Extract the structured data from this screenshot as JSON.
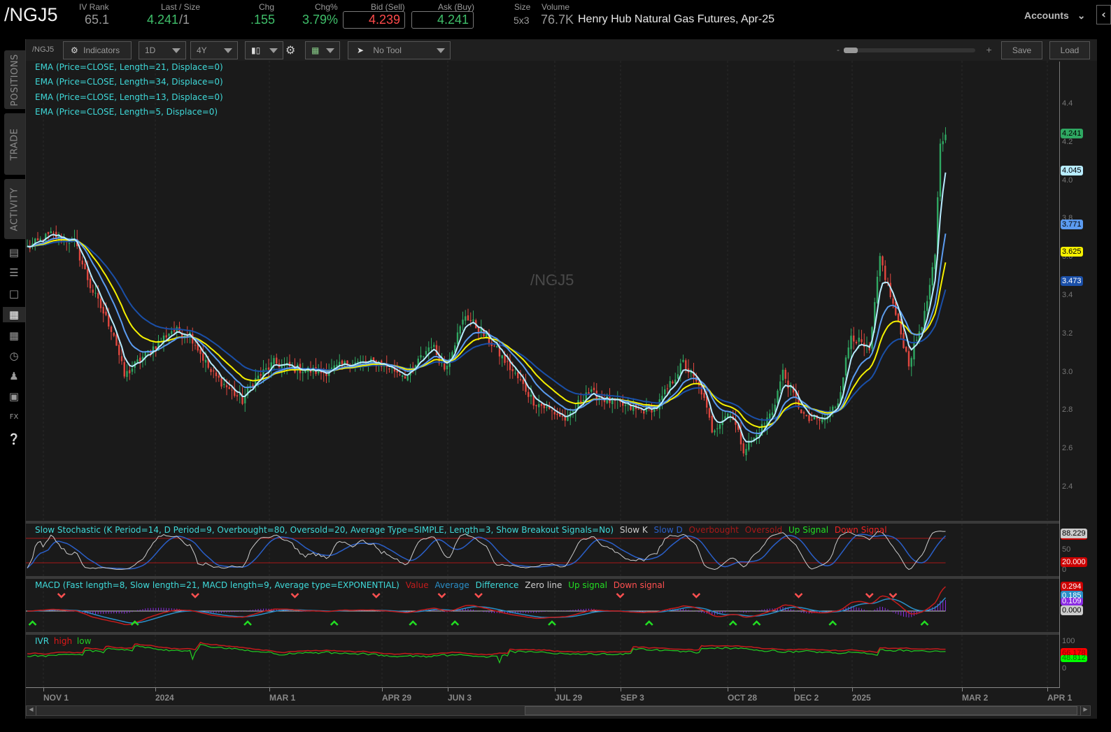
{
  "header": {
    "symbol": "/NGJ5",
    "iv_rank_label": "IV Rank",
    "iv_rank": "65.1",
    "last_size_label": "Last / Size",
    "last": "4.241",
    "size_suffix": "/1",
    "chg_label": "Chg",
    "chg": ".155",
    "chg_pct_label": "Chg%",
    "chg_pct": "3.79%",
    "bid_label": "Bid (Sell)",
    "bid": "4.239",
    "ask_label": "Ask (Buy)",
    "ask": "4.241",
    "size_label": "Size",
    "size": "5x3",
    "volume_label": "Volume",
    "volume": "76.7K",
    "description": "Henry Hub Natural Gas Futures, Apr-25",
    "accounts_label": "Accounts"
  },
  "sidebar": {
    "tabs": [
      "POSITIONS",
      "TRADE",
      "ACTIVITY"
    ],
    "icons": [
      "analyze-icon",
      "watchlist-icon",
      "tv-icon",
      "chart-icon",
      "grid-icon",
      "clock-icon",
      "community-icon",
      "calendar-icon",
      "fx-icon",
      "help-icon"
    ]
  },
  "toolbar": {
    "symbol": "/NGJ5",
    "indicators_label": "Indicators",
    "aggregation": "1D",
    "timeframe": "4Y",
    "drawing_tool": "No Tool",
    "zoom_minus": "-",
    "zoom_plus": "+",
    "save_label": "Save",
    "load_label": "Load"
  },
  "studies": {
    "ema": [
      "EMA (Price=CLOSE, Length=21, Displace=0)",
      "EMA (Price=CLOSE, Length=34, Displace=0)",
      "EMA (Price=CLOSE, Length=13, Displace=0)",
      "EMA (Price=CLOSE, Length=5, Displace=0)"
    ],
    "watermark": "/NGJ5",
    "stoch": {
      "title": "Slow Stochastic (K Period=14, D Period=9, Overbought=80, Oversold=20, Average Type=SIMPLE, Length=3, Show Breakout Signals=No)",
      "legend": [
        "Slow K",
        "Slow D",
        "Overbought",
        "Oversold",
        "Up Signal",
        "Down Signal"
      ],
      "values": {
        "k": "88.229",
        "mid": "50",
        "os": "20.000",
        "zero": "0"
      }
    },
    "macd": {
      "title": "MACD (Fast length=8, Slow length=21, MACD length=9, Average type=EXPONENTIAL)",
      "legend": [
        "Value",
        "Average",
        "Difference",
        "Zero line",
        "Up signal",
        "Down signal"
      ],
      "values": {
        "value": "0.294",
        "avg": "0.185",
        "diff": "0.109",
        "zero": "0.000"
      }
    },
    "ivr": {
      "legend": [
        "IVR",
        "high",
        "low"
      ],
      "values": {
        "top": "100",
        "high": "66.178",
        "low": "48.812",
        "zero": "0"
      }
    }
  },
  "colors": {
    "up": "#2fa862",
    "down": "#e0473f",
    "ema5": "#b8ecff",
    "ema13": "#5b9bf0",
    "ema21": "#f5f000",
    "ema34": "#1a4fa8",
    "accent": "#3fd9d9"
  },
  "chart_data": {
    "type": "candlestick",
    "price_axis": {
      "ticks": [
        "4.4",
        "4.2",
        "4.0",
        "3.8",
        "3.6",
        "3.4",
        "3.2",
        "3.0",
        "2.8",
        "2.6",
        "2.4"
      ],
      "range": [
        2.3,
        4.55
      ]
    },
    "x_ticks": [
      "NOV 1",
      "2024",
      "MAR 1",
      "APR 29",
      "JUN 3",
      "JUL 29",
      "SEP 3",
      "OCT 28",
      "DEC 2",
      "2025",
      "MAR 2",
      "APR 1"
    ],
    "price_labels": {
      "last": "4.241",
      "ema5": "4.045",
      "ema13": "3.771",
      "ema21": "3.625",
      "ema34": "3.473"
    },
    "close_anchors": [
      [
        0,
        3.65
      ],
      [
        9,
        3.72
      ],
      [
        18,
        3.68
      ],
      [
        24,
        3.45
      ],
      [
        33,
        3.2
      ],
      [
        37,
        2.98
      ],
      [
        44,
        3.08
      ],
      [
        55,
        3.22
      ],
      [
        62,
        3.2
      ],
      [
        70,
        3.0
      ],
      [
        82,
        2.85
      ],
      [
        86,
        2.95
      ],
      [
        94,
        3.05
      ],
      [
        102,
        3.02
      ],
      [
        113,
        3.0
      ],
      [
        123,
        3.05
      ],
      [
        134,
        3.05
      ],
      [
        145,
        2.98
      ],
      [
        154,
        3.15
      ],
      [
        159,
        3.02
      ],
      [
        167,
        3.3
      ],
      [
        177,
        3.15
      ],
      [
        188,
        2.95
      ],
      [
        193,
        2.85
      ],
      [
        206,
        2.75
      ],
      [
        213,
        2.9
      ],
      [
        222,
        2.85
      ],
      [
        233,
        2.8
      ],
      [
        240,
        2.82
      ],
      [
        250,
        3.05
      ],
      [
        257,
        2.9
      ],
      [
        261,
        2.7
      ],
      [
        268,
        2.8
      ],
      [
        273,
        2.6
      ],
      [
        277,
        2.65
      ],
      [
        284,
        2.8
      ],
      [
        288,
        3.0
      ],
      [
        292,
        2.88
      ],
      [
        297,
        2.75
      ],
      [
        304,
        2.75
      ],
      [
        309,
        2.85
      ],
      [
        314,
        3.2
      ],
      [
        321,
        3.1
      ],
      [
        325,
        3.6
      ],
      [
        329,
        3.4
      ],
      [
        333,
        3.2
      ],
      [
        336,
        3.05
      ],
      [
        342,
        3.3
      ],
      [
        346,
        3.6
      ],
      [
        348,
        4.2
      ],
      [
        350,
        4.241
      ]
    ]
  }
}
